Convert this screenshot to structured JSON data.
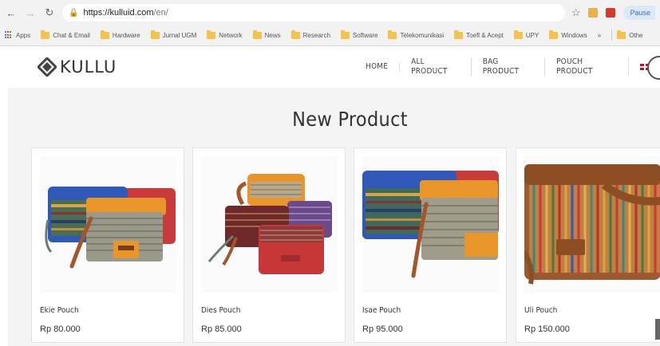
{
  "browser": {
    "url_host": "https://kulluid.com",
    "url_path": "/en/",
    "pause_label": "Pause"
  },
  "bookmarks": [
    {
      "label": "Apps",
      "icon": "apps-grid-icon"
    },
    {
      "label": "Chat & Email",
      "icon": "folder-icon"
    },
    {
      "label": "Hardware",
      "icon": "folder-icon"
    },
    {
      "label": "Jurnal UGM",
      "icon": "folder-icon"
    },
    {
      "label": "Network",
      "icon": "folder-icon"
    },
    {
      "label": "News",
      "icon": "folder-icon"
    },
    {
      "label": "Research",
      "icon": "folder-icon"
    },
    {
      "label": "Software",
      "icon": "folder-icon"
    },
    {
      "label": "Telekomunikasi",
      "icon": "folder-icon"
    },
    {
      "label": "Toefl & Acept",
      "icon": "folder-icon"
    },
    {
      "label": "UPY",
      "icon": "folder-icon"
    },
    {
      "label": "Windows",
      "icon": "folder-icon"
    }
  ],
  "bookmarks_more": "»",
  "bookmarks_other": "Othe",
  "site": {
    "logo_text": "KULLU",
    "nav": [
      "HOME",
      "ALL PRODUCT",
      "BAG PRODUCT",
      "POUCH PRODUCT"
    ],
    "section_title": "New Product"
  },
  "products": [
    {
      "name": "Ekie Pouch",
      "price": "Rp 80.000"
    },
    {
      "name": "Dies Pouch",
      "price": "Rp 85.000"
    },
    {
      "name": "Isae Pouch",
      "price": "Rp 95.000"
    },
    {
      "name": "Uli Pouch",
      "price": "Rp 150.000"
    }
  ],
  "colors": {
    "accent_blue": "#3b6fd1",
    "pouch_orange": "#e8952a",
    "pouch_red": "#c93a3a",
    "pouch_blue": "#2f58b8",
    "leather": "#a5552a"
  }
}
